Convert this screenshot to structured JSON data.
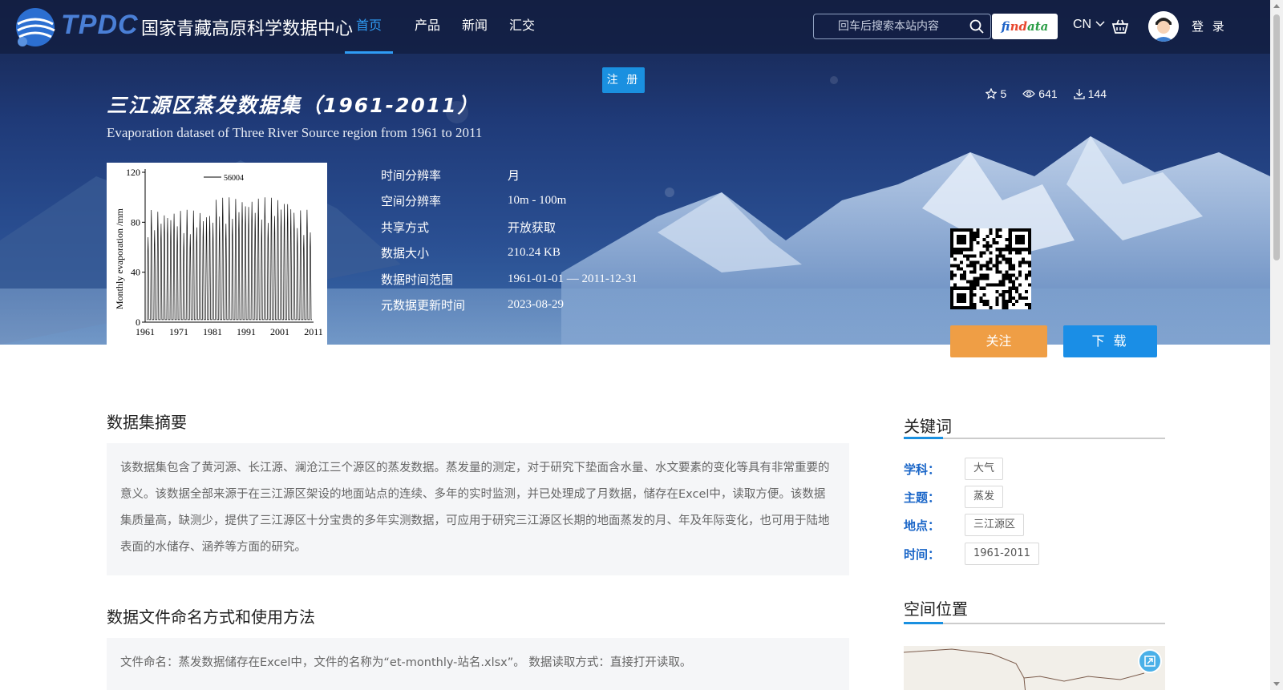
{
  "header": {
    "logo_mark": "TPDC",
    "logo_text": "国家青藏高原科学数据中心",
    "nav": [
      "首页",
      "产品",
      "新闻",
      "汇交"
    ],
    "search_placeholder": "回车后搜索本站内容",
    "findata": [
      "f",
      "ind",
      "ata"
    ],
    "lang": "CN",
    "login": "登 录",
    "register": "注 册"
  },
  "dataset": {
    "title": "三江源区蒸发数据集（1961-2011）",
    "subtitle": "Evaporation dataset of Three River Source region from 1961 to 2011",
    "stars": "5",
    "views": "641",
    "downloads": "144",
    "meta": [
      {
        "k": "时间分辨率",
        "v": "月"
      },
      {
        "k": "空间分辨率",
        "v": "10m - 100m"
      },
      {
        "k": "共享方式",
        "v": "开放获取"
      },
      {
        "k": "数据大小",
        "v": "210.24 KB"
      },
      {
        "k": "数据时间范围",
        "v": "1961-01-01 — 2011-12-31"
      },
      {
        "k": "元数据更新时间",
        "v": "2023-08-29"
      }
    ],
    "follow": "关注",
    "download": "下 载"
  },
  "thumbnail": {
    "ylabel": "Monthly evaporation /mm",
    "legend": "56004",
    "yticks": [
      "120",
      "80",
      "40",
      "0"
    ],
    "xticks": [
      "1961",
      "1971",
      "1981",
      "1991",
      "2001",
      "2011"
    ]
  },
  "content": {
    "abstract_title": "数据集摘要",
    "abstract": "该数据集包含了黄河源、长江源、澜沧江三个源区的蒸发数据。蒸发量的测定，对于研究下垫面含水量、水文要素的变化等具有非常重要的意义。该数据全部来源于在三江源区架设的地面站点的连续、多年的实时监测，并已处理成了月数据，储存在Excel中，读取方便。该数据集质量高，缺测少，提供了三江源区十分宝贵的多年实测数据，可应用于研究三江源区长期的地面蒸发的月、年及年际变化，也可用于陆地表面的水储存、涵养等方面的研究。",
    "naming_title": "数据文件命名方式和使用方法",
    "naming": "文件命名：蒸发数据储存在Excel中，文件的名称为“et-monthly-站名.xlsx”。 数据读取方式：直接打开读取。"
  },
  "sidebar": {
    "keywords_title": "关键词",
    "keywords": [
      {
        "label": "学科：",
        "tag": "大气"
      },
      {
        "label": "主题：",
        "tag": "蒸发"
      },
      {
        "label": "地点：",
        "tag": "三江源区"
      },
      {
        "label": "时间：",
        "tag": "1961-2011"
      }
    ],
    "location_title": "空间位置"
  },
  "colors": {
    "accent": "#1a90e0",
    "follow": "#ef9e45",
    "keyword_label": "#1a66c8"
  }
}
